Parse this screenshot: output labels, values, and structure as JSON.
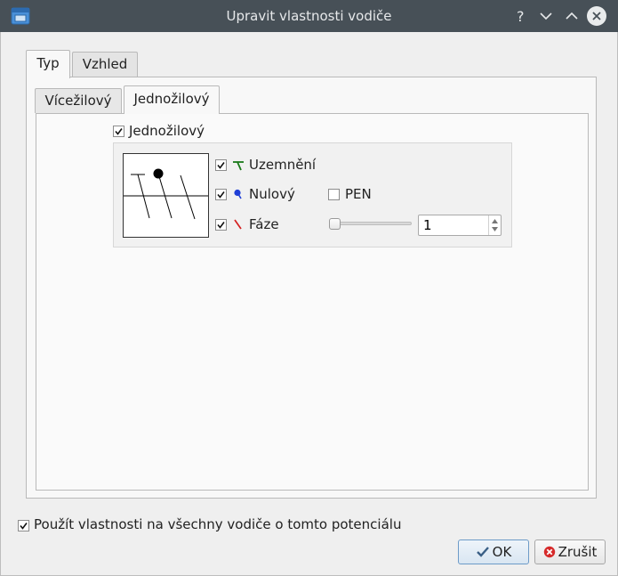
{
  "window": {
    "title": "Upravit vlastnosti vodiče",
    "buttons": [
      "help-button",
      "minimize-button",
      "maximize-button",
      "close-button"
    ]
  },
  "outer_tabs": [
    {
      "label": "Typ",
      "active": true
    },
    {
      "label": "Vzhled",
      "active": false
    }
  ],
  "inner_tabs": [
    {
      "label": "Vícežilový",
      "active": false
    },
    {
      "label": "Jednožilový",
      "active": true
    }
  ],
  "single_wire": {
    "checkbox_label": "Jednožilový",
    "checked": true,
    "ground": {
      "label": "Uzemnění",
      "checked": true,
      "icon": "ground-symbol-icon",
      "color": "#1a7a1a"
    },
    "neutral": {
      "label": "Nulový",
      "checked": true,
      "icon": "neutral-symbol-icon",
      "color": "#1f3fd6"
    },
    "pen": {
      "label": "PEN",
      "checked": false
    },
    "phase": {
      "label": "Fáze",
      "checked": true,
      "icon": "phase-symbol-icon",
      "color": "#d42020",
      "count_value": "1"
    }
  },
  "apply_all": {
    "label": "Použít vlastnosti na všechny vodiče o tomto potenciálu",
    "checked": true
  },
  "buttons": {
    "ok_label": "OK",
    "cancel_label": "Zrušit"
  },
  "colors": {
    "titlebar": "#475057",
    "accent": "#6d9bc8"
  }
}
